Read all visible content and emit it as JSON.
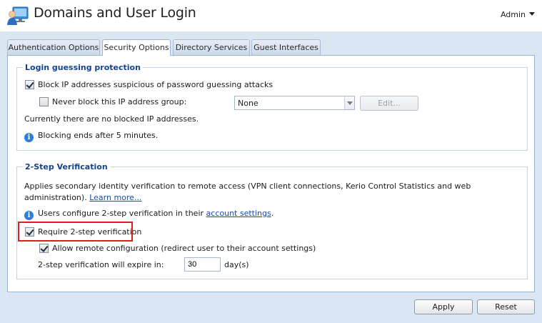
{
  "header": {
    "title": "Domains and User Login",
    "user_menu": "Admin",
    "app_icon": "users-computer-icon"
  },
  "tabs": [
    {
      "label": "Authentication Options",
      "active": false
    },
    {
      "label": "Security Options",
      "active": true
    },
    {
      "label": "Directory Services",
      "active": false
    },
    {
      "label": "Guest Interfaces",
      "active": false
    }
  ],
  "login_guessing": {
    "legend": "Login guessing protection",
    "block_ip_label": "Block IP addresses suspicious of password guessing attacks",
    "block_ip_checked": true,
    "never_block_label": "Never block this IP address group:",
    "never_block_checked": false,
    "group_select_value": "None",
    "edit_button": "Edit...",
    "no_blocked_text": "Currently there are no blocked IP addresses.",
    "blocking_ends_text": "Blocking ends after 5 minutes."
  },
  "two_step": {
    "legend": "2-Step Verification",
    "description": "Applies secondary identity verification to remote access (VPN client connections, Kerio Control Statistics and web administration).",
    "learn_more_link": "Learn more...",
    "users_configure_text": "Users configure 2-step verification in their",
    "account_settings_link": "account settings",
    "period": ".",
    "require_label": "Require 2-step verification",
    "require_checked": true,
    "allow_remote_label": "Allow remote configuration (redirect user to their account settings)",
    "allow_remote_checked": true,
    "expire_label": "2-step verification will expire in:",
    "expire_value": "30",
    "expire_unit": "day(s)"
  },
  "footer": {
    "apply_button": "Apply",
    "reset_button": "Reset"
  },
  "colors": {
    "legend_text": "#15428b",
    "link": "#1a4ba3",
    "content_bg": "#dbe6f3",
    "highlight_border": "#e01e1e",
    "info_icon": "#2f7dd6"
  }
}
